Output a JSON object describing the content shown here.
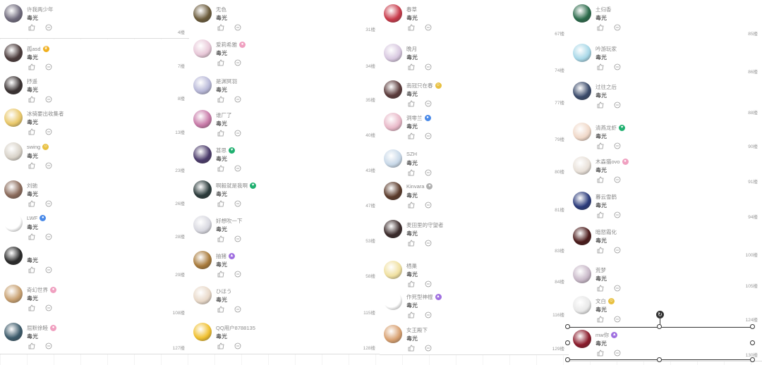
{
  "columns": [
    {
      "items": [
        {
          "name": "许我两少年",
          "text": "毒光",
          "floor": "4楼",
          "badge": "",
          "av": "#6f6a7c"
        },
        {
          "name": "孤asd",
          "text": "毒光",
          "floor": "7楼",
          "badge": "crown",
          "av": "#4a3a3a"
        },
        {
          "name": "抒遥",
          "text": "毒光",
          "floor": "8楼",
          "badge": "",
          "av": "#3a3232"
        },
        {
          "name": "冰骑要出收集者",
          "text": "毒光",
          "floor": "13楼",
          "badge": "",
          "av": "#e9c86a"
        },
        {
          "name": "swing",
          "text": "毒光",
          "floor": "23楼",
          "badge": "emoji",
          "av": "#d8d2c8"
        },
        {
          "name": "刘驰",
          "text": "毒光",
          "floor": "26楼",
          "badge": "",
          "av": "#8a6a5a"
        },
        {
          "name": "LWF",
          "text": "毒光",
          "floor": "28楼",
          "badge": "blue",
          "av": "#ffffff"
        },
        {
          "name": "",
          "text": "毒光",
          "floor": "29楼",
          "badge": "",
          "av": "#2a2a2a"
        },
        {
          "name": "奇幻世界",
          "text": "毒光",
          "floor": "108楼",
          "badge": "pink",
          "av": "#c8a070"
        },
        {
          "name": "屈默徐睦",
          "text": "毒光",
          "floor": "127楼",
          "badge": "pink",
          "av": "#3c5a6a"
        }
      ]
    },
    {
      "items": [
        {
          "name": "无色",
          "text": "毒光",
          "floor": "31楼",
          "badge": "",
          "av": "#6a5a3a"
        },
        {
          "name": "爱莉希雅",
          "text": "毒光",
          "floor": "34楼",
          "badge": "pink",
          "av": "#e8c8d8"
        },
        {
          "name": "是渊冥羽",
          "text": "毒光",
          "floor": "35楼",
          "badge": "",
          "av": "#b8b8d8"
        },
        {
          "name": "谁厂了",
          "text": "毒光",
          "floor": "40楼",
          "badge": "",
          "av": "#c87aa8"
        },
        {
          "name": "甚思",
          "text": "毒光",
          "floor": "43楼",
          "badge": "green",
          "av": "#4a3a6a"
        },
        {
          "name": "啊毅就是我啊",
          "text": "毒光",
          "floor": "47楼",
          "badge": "green",
          "av": "#2a3a3a"
        },
        {
          "name": "好想吹一下",
          "text": "毒光",
          "floor": "53楼",
          "badge": "",
          "av": "#d8d8e0"
        },
        {
          "name": "抽猪",
          "text": "毒光",
          "floor": "58楼",
          "badge": "purple",
          "av": "#a87a3a"
        },
        {
          "name": "ひほう",
          "text": "毒光",
          "floor": "115楼",
          "badge": "",
          "av": "#e8d8c8"
        },
        {
          "name": "QQ用户8788135",
          "text": "毒光",
          "floor": "128楼",
          "badge": "",
          "av": "#f0c030"
        }
      ]
    },
    {
      "items": [
        {
          "name": "春草",
          "text": "毒光",
          "floor": "67楼",
          "badge": "",
          "av": "#c83a4a"
        },
        {
          "name": "晚月",
          "text": "毒光",
          "floor": "74楼",
          "badge": "",
          "av": "#d8c8e0"
        },
        {
          "name": "南冠只在春",
          "text": "毒光",
          "floor": "77楼",
          "badge": "emoji",
          "av": "#5a3a3a"
        },
        {
          "name": "洞零兰",
          "text": "毒光",
          "floor": "79楼",
          "badge": "blue",
          "av": "#e8b8c8"
        },
        {
          "name": "SZH",
          "text": "毒光",
          "floor": "80楼",
          "badge": "",
          "av": "#c8d8e8"
        },
        {
          "name": "Kinvara",
          "text": "毒光",
          "floor": "81楼",
          "badge": "gray",
          "av": "#5a3a2a"
        },
        {
          "name": "麦田里的守望者",
          "text": "毒光",
          "floor": "83楼",
          "badge": "",
          "av": "#3a2a2a"
        },
        {
          "name": "栖巢",
          "text": "毒光",
          "floor": "84楼",
          "badge": "",
          "av": "#f0e0a0"
        },
        {
          "name": "作死型神棍",
          "text": "毒光",
          "floor": "116楼",
          "badge": "purple",
          "av": "#ffffff"
        },
        {
          "name": "女王殿下",
          "text": "毒光",
          "floor": "129楼",
          "badge": "",
          "av": "#d8a070"
        }
      ]
    },
    {
      "items": [
        {
          "name": "土归香",
          "text": "毒光",
          "floor": "85楼",
          "badge": "",
          "av": "#2a6a4a"
        },
        {
          "name": "吟游玩家",
          "text": "毒光",
          "floor": "86楼",
          "badge": "",
          "av": "#a8d8e8"
        },
        {
          "name": "过往之后",
          "text": "毒光",
          "floor": "88楼",
          "badge": "",
          "av": "#3a4a6a"
        },
        {
          "name": "清燕龙虾",
          "text": "毒光",
          "floor": "90楼",
          "badge": "green",
          "av": "#f0d8c8"
        },
        {
          "name": "木森猫ovo",
          "text": "毒光",
          "floor": "91楼",
          "badge": "pink",
          "av": "#e8e0d8"
        },
        {
          "name": "暮云雪鹤",
          "text": "毒光",
          "floor": "94楼",
          "badge": "",
          "av": "#2a3a7a"
        },
        {
          "name": "暗怒霜化",
          "text": "毒光",
          "floor": "100楼",
          "badge": "",
          "av": "#4a1a1a"
        },
        {
          "name": "荒梦",
          "text": "毒光",
          "floor": "105楼",
          "badge": "",
          "av": "#c8b8c8"
        },
        {
          "name": "文白",
          "text": "毒光",
          "floor": "124楼",
          "badge": "emoji",
          "av": "#e8e8e8"
        },
        {
          "name": "mw你",
          "text": "毒光",
          "floor": "130楼",
          "badge": "purple",
          "av": "#8a1a2a"
        }
      ]
    }
  ]
}
